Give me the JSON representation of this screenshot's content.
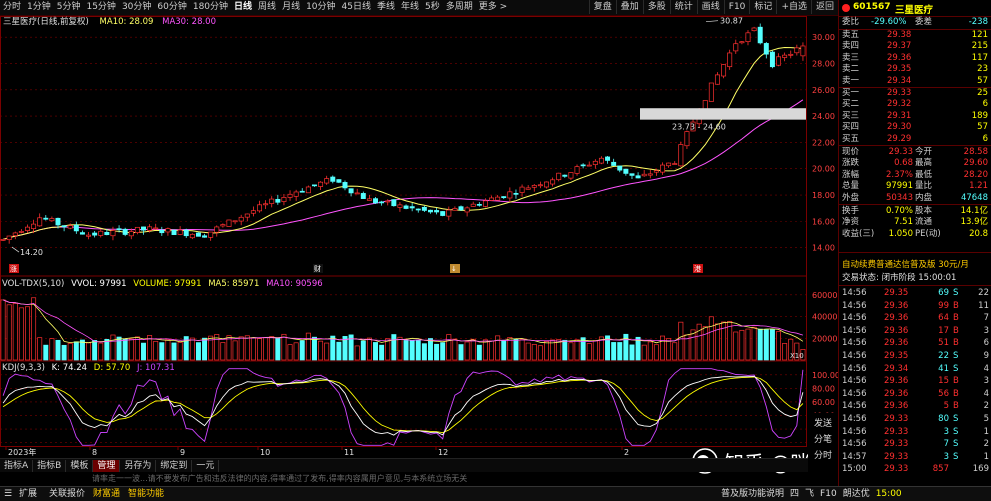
{
  "toolbar": {
    "periods": [
      "分时",
      "1分钟",
      "5分钟",
      "15分钟",
      "30分钟",
      "60分钟",
      "180分钟",
      "日线",
      "周线",
      "月线",
      "10分钟",
      "45日线",
      "季线",
      "年线",
      "5秒",
      "多周期",
      "更多 >"
    ],
    "active_period": "日线",
    "tools": [
      "复盘",
      "叠加",
      "多股",
      "统计",
      "画线",
      "F10",
      "标记",
      "+自选",
      "返回"
    ]
  },
  "chart": {
    "legend_title": "三星医疗(日线,前复权)",
    "ma10_label": "MA10: 28.09",
    "ma30_label": "MA30: 28.00",
    "max_label": "30.87",
    "min_label": "14.20",
    "range_label": "23.73 - 24.60",
    "markers": [
      "涨",
      "财",
      "↓",
      "港"
    ],
    "vol_legend": {
      "name": "VOL-TDX(5,10)",
      "vvol": "VVOL: 97991",
      "volume": "VOLUME: 97991",
      "ma5": "MA5: 85971",
      "ma10": "MA10: 90596"
    },
    "vol_unit": "X10",
    "kdj_legend": {
      "name": "KDJ(9,3,3)",
      "k": "K: 74.24",
      "d": "D: 57.70",
      "j": "J: 107.31"
    },
    "x_labels": [
      "2023年",
      "8",
      "9",
      "10",
      "11",
      "12",
      "2"
    ]
  },
  "chart_data": [
    {
      "type": "candlestick",
      "title": "三星医疗(日线,前复权)",
      "ylim": [
        12,
        31
      ],
      "y_ticks": [
        14.0,
        16.0,
        18.0,
        20.0,
        22.0,
        24.0,
        26.0,
        28.0,
        30.0
      ],
      "annotations": {
        "high": 30.87,
        "low": 14.2,
        "range": "23.73 - 24.60"
      },
      "x": [
        "2023年",
        "8",
        "9",
        "10",
        "11",
        "12",
        "2"
      ],
      "series": [
        {
          "name": "MA10",
          "last": 28.09
        },
        {
          "name": "MA30",
          "last": 28.0
        }
      ]
    },
    {
      "type": "bar",
      "title": "VOL-TDX(5,10)",
      "ylim": [
        0,
        70000
      ],
      "y_ticks": [
        20000,
        40000,
        60000
      ],
      "series": [
        {
          "name": "VOLUME",
          "last": 97991
        },
        {
          "name": "MA5",
          "last": 85971
        },
        {
          "name": "MA10",
          "last": 90596
        }
      ]
    },
    {
      "type": "line",
      "title": "KDJ(9,3,3)",
      "ylim": [
        -5,
        110
      ],
      "y_ticks": [
        0.0,
        20.0,
        40.0,
        60.0,
        80.0,
        100.0
      ],
      "series": [
        {
          "name": "K",
          "last": 74.24
        },
        {
          "name": "D",
          "last": 57.7
        },
        {
          "name": "J",
          "last": 107.31
        }
      ]
    }
  ],
  "bottom_tabs": [
    "指标A",
    "指标B",
    "模板",
    "管理",
    "另存为",
    "绑定到",
    "一元"
  ],
  "active_tab": "管理",
  "notice": "请率走一一波...请不要发布广告和违反法律的内容,得率通过了发布,得率内容属用户意见,与本系统立场无关",
  "statusbar": {
    "left": [
      "扩展",
      "关联报价",
      "财富通",
      "智能功能"
    ],
    "right": [
      "普及版功能说明",
      "四",
      "飞",
      "F10",
      "朗达优",
      "15:00"
    ]
  },
  "watermark": "知乎 @咪咪小超人",
  "right_panel": {
    "code": "601567",
    "name": "三星医疗",
    "weibi_label": "委比",
    "weibi": "-29.60%",
    "weicha_label": "委差",
    "weicha": "-238",
    "asks": [
      {
        "label": "卖五",
        "price": "29.38",
        "vol": "121"
      },
      {
        "label": "卖四",
        "price": "29.37",
        "vol": "215"
      },
      {
        "label": "卖三",
        "price": "29.36",
        "vol": "117"
      },
      {
        "label": "卖二",
        "price": "29.35",
        "vol": "23"
      },
      {
        "label": "卖一",
        "price": "29.34",
        "vol": "57"
      }
    ],
    "bids": [
      {
        "label": "买一",
        "price": "29.33",
        "vol": "25"
      },
      {
        "label": "买二",
        "price": "29.32",
        "vol": "6"
      },
      {
        "label": "买三",
        "price": "29.31",
        "vol": "189"
      },
      {
        "label": "买四",
        "price": "29.30",
        "vol": "57"
      },
      {
        "label": "买五",
        "price": "29.29",
        "vol": "6"
      }
    ],
    "stats": [
      {
        "l1": "现价",
        "v1": "29.33",
        "l2": "今开",
        "v2": "28.58"
      },
      {
        "l1": "涨跌",
        "v1": "0.68",
        "l2": "最高",
        "v2": "29.60"
      },
      {
        "l1": "涨幅",
        "v1": "2.37%",
        "l2": "最低",
        "v2": "28.20"
      },
      {
        "l1": "总量",
        "v1": "97991",
        "l2": "量比",
        "v2": "1.21"
      },
      {
        "l1": "外盘",
        "v1": "50343",
        "l2": "内盘",
        "v2": "47648"
      }
    ],
    "stats2": [
      {
        "l1": "换手",
        "v1": "0.70%",
        "l2": "股本",
        "v2": "14.1亿"
      },
      {
        "l1": "净资",
        "v1": "7.51",
        "l2": "流通",
        "v2": "13.9亿"
      },
      {
        "l1": "收益(三)",
        "v1": "1.050",
        "l2": "PE(动)",
        "v2": "20.8"
      }
    ],
    "promo": "自动续费普通达信普及版  30元/月",
    "trade_status": "交易状态: 闭市阶段  15:00:01",
    "ticks": [
      {
        "t": "14:56",
        "p": "29.35",
        "v": "69",
        "s": "S",
        "n": "22"
      },
      {
        "t": "14:56",
        "p": "29.36",
        "v": "99",
        "s": "B",
        "n": "11"
      },
      {
        "t": "14:56",
        "p": "29.36",
        "v": "64",
        "s": "B",
        "n": "7"
      },
      {
        "t": "14:56",
        "p": "29.36",
        "v": "17",
        "s": "B",
        "n": "3"
      },
      {
        "t": "14:56",
        "p": "29.36",
        "v": "51",
        "s": "B",
        "n": "6"
      },
      {
        "t": "14:56",
        "p": "29.35",
        "v": "22",
        "s": "S",
        "n": "9"
      },
      {
        "t": "14:56",
        "p": "29.34",
        "v": "41",
        "s": "S",
        "n": "4"
      },
      {
        "t": "14:56",
        "p": "29.36",
        "v": "15",
        "s": "B",
        "n": "3"
      },
      {
        "t": "14:56",
        "p": "29.36",
        "v": "56",
        "s": "B",
        "n": "4"
      },
      {
        "t": "14:56",
        "p": "29.36",
        "v": "5",
        "s": "B",
        "n": "2"
      },
      {
        "t": "14:56",
        "p": "29.33",
        "v": "80",
        "s": "S",
        "n": "5"
      },
      {
        "t": "14:56",
        "p": "29.33",
        "v": "3",
        "s": "S",
        "n": "1"
      },
      {
        "t": "14:56",
        "p": "29.33",
        "v": "7",
        "s": "S",
        "n": "2"
      },
      {
        "t": "14:57",
        "p": "29.33",
        "v": "3",
        "s": "S",
        "n": "1"
      },
      {
        "t": "15:00",
        "p": "29.33",
        "v": "857",
        "s": "",
        "n": "169"
      }
    ],
    "side_buttons": [
      "发送",
      "分笔",
      "分时"
    ]
  },
  "colors": {
    "up": "#ff3030",
    "down": "#54ffff",
    "ma10": "#ffff66",
    "ma30": "#ff55ff",
    "grid": "#7a0000",
    "k": "#ffffff",
    "d": "#ffff00",
    "j": "#cc44ff",
    "axis_text": "#ff4040"
  }
}
